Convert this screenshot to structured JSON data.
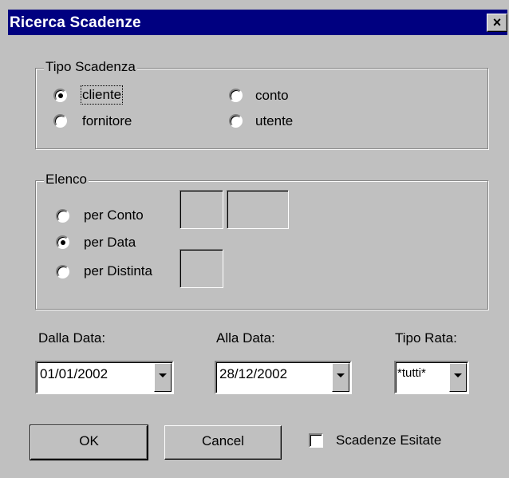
{
  "window": {
    "title": "Ricerca Scadenze",
    "close_glyph": "×"
  },
  "tipo_scadenza": {
    "legend": "Tipo Scadenza",
    "options": [
      "cliente",
      "fornitore",
      "conto",
      "utente"
    ],
    "selected": "cliente"
  },
  "elenco": {
    "legend": "Elenco",
    "options": [
      "per Conto",
      "per Data",
      "per Distinta"
    ],
    "selected": "per Data"
  },
  "dalla_data": {
    "label": "Dalla Data:",
    "value": "01/01/2002"
  },
  "alla_data": {
    "label": "Alla Data:",
    "value": "28/12/2002"
  },
  "tipo_rata": {
    "label": "Tipo Rata:",
    "value": "*tutti*"
  },
  "buttons": {
    "ok": "OK",
    "cancel": "Cancel"
  },
  "scadenze_esitate": {
    "label": "Scadenze Esitate",
    "checked": false
  },
  "colors": {
    "face": "#c0c0c0",
    "title_bar": "#000080",
    "title_text": "#ffffff"
  },
  "icons": {
    "close": "close-icon",
    "dropdown": "chevron-down-icon"
  }
}
